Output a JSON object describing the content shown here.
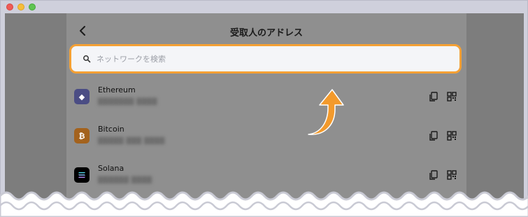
{
  "window": {
    "controls": [
      "close",
      "minimize",
      "zoom"
    ]
  },
  "header": {
    "back_icon": "chevron-left-icon",
    "title": "受取人のアドレス"
  },
  "search": {
    "icon": "search-icon",
    "placeholder": "ネットワークを検索"
  },
  "networks": [
    {
      "name": "Ethereum",
      "icon": "ethereum-icon",
      "symbol": "◆"
    },
    {
      "name": "Bitcoin",
      "icon": "bitcoin-icon",
      "symbol": "₿"
    },
    {
      "name": "Solana",
      "icon": "solana-icon",
      "symbol": "≡"
    }
  ],
  "row_actions": {
    "copy_icon": "copy-icon",
    "qr_icon": "qr-code-icon"
  },
  "colors": {
    "highlight": "#f4a034",
    "arrow": "#f39a2c",
    "overlay": "#7d7d7d"
  }
}
